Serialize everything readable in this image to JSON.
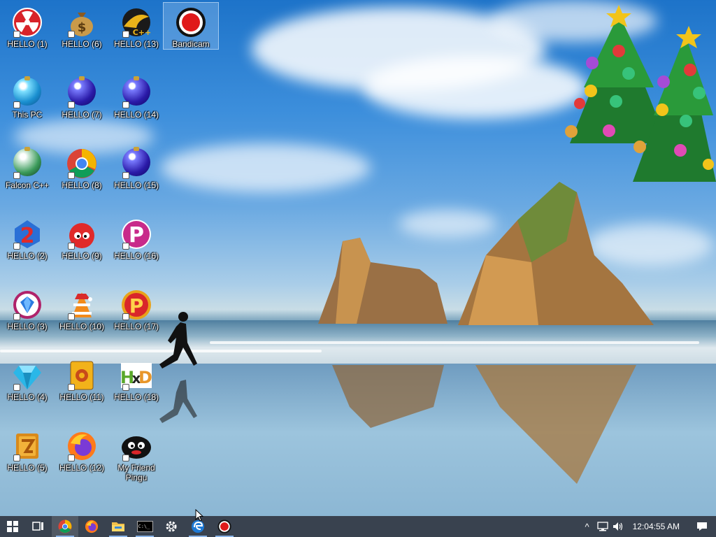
{
  "desktop": {
    "icons": [
      {
        "label": "HELLO (1)",
        "icon": "radiation-icon"
      },
      {
        "label": "HELLO (6)",
        "icon": "money-bag-icon"
      },
      {
        "label": "HELLO (13)",
        "icon": "cpp-falcon-icon"
      },
      {
        "label": "Bandicam",
        "icon": "record-icon"
      },
      {
        "label": "This PC",
        "icon": "computer-orb-icon"
      },
      {
        "label": "HELLO (7)",
        "icon": "blue-orb-icon"
      },
      {
        "label": "HELLO (14)",
        "icon": "blue-orb-icon"
      },
      {
        "label": "Falcon C++",
        "icon": "recycle-orb-icon"
      },
      {
        "label": "HELLO (8)",
        "icon": "chrome-icon"
      },
      {
        "label": "HELLO (15)",
        "icon": "blue-orb-icon"
      },
      {
        "label": "HELLO (2)",
        "icon": "number-two-icon"
      },
      {
        "label": "HELLO (9)",
        "icon": "red-fuzzball-icon"
      },
      {
        "label": "HELLO (16)",
        "icon": "p-ball-icon"
      },
      {
        "label": "HELLO (3)",
        "icon": "diamond-ring-icon"
      },
      {
        "label": "HELLO (10)",
        "icon": "santa-cone-icon"
      },
      {
        "label": "HELLO (17)",
        "icon": "p-ball-gold-icon"
      },
      {
        "label": "HELLO (4)",
        "icon": "diamond-icon"
      },
      {
        "label": "HELLO (11)",
        "icon": "mahjong-tile-icon"
      },
      {
        "label": "HELLO (18)",
        "icon": "hxd-icon"
      },
      {
        "label": "HELLO (5)",
        "icon": "gold-tile-icon"
      },
      {
        "label": "HELLO (12)",
        "icon": "firefox-icon"
      },
      {
        "label": "My Friend Pingu",
        "icon": "pingu-icon"
      }
    ]
  },
  "taskbar": {
    "buttons": [
      {
        "name": "start-button",
        "icon": "windows-logo-icon"
      },
      {
        "name": "task-view-button",
        "icon": "task-view-icon"
      },
      {
        "name": "chrome-taskbar-button",
        "icon": "chrome-icon"
      },
      {
        "name": "firefox-taskbar-button",
        "icon": "firefox-icon"
      },
      {
        "name": "file-explorer-taskbar-button",
        "icon": "folder-icon"
      },
      {
        "name": "cmd-taskbar-button",
        "icon": "terminal-icon",
        "text": "C:\\_"
      },
      {
        "name": "settings-taskbar-button",
        "icon": "gear-icon"
      },
      {
        "name": "edge-taskbar-button",
        "icon": "edge-icon"
      },
      {
        "name": "bandicam-taskbar-button",
        "icon": "record-icon"
      }
    ],
    "tray": {
      "chevron": "^",
      "clock": "12:04:55 AM"
    }
  },
  "colors": {
    "taskbar_bg": "#1e2837",
    "selection": "#a0c8f0"
  }
}
